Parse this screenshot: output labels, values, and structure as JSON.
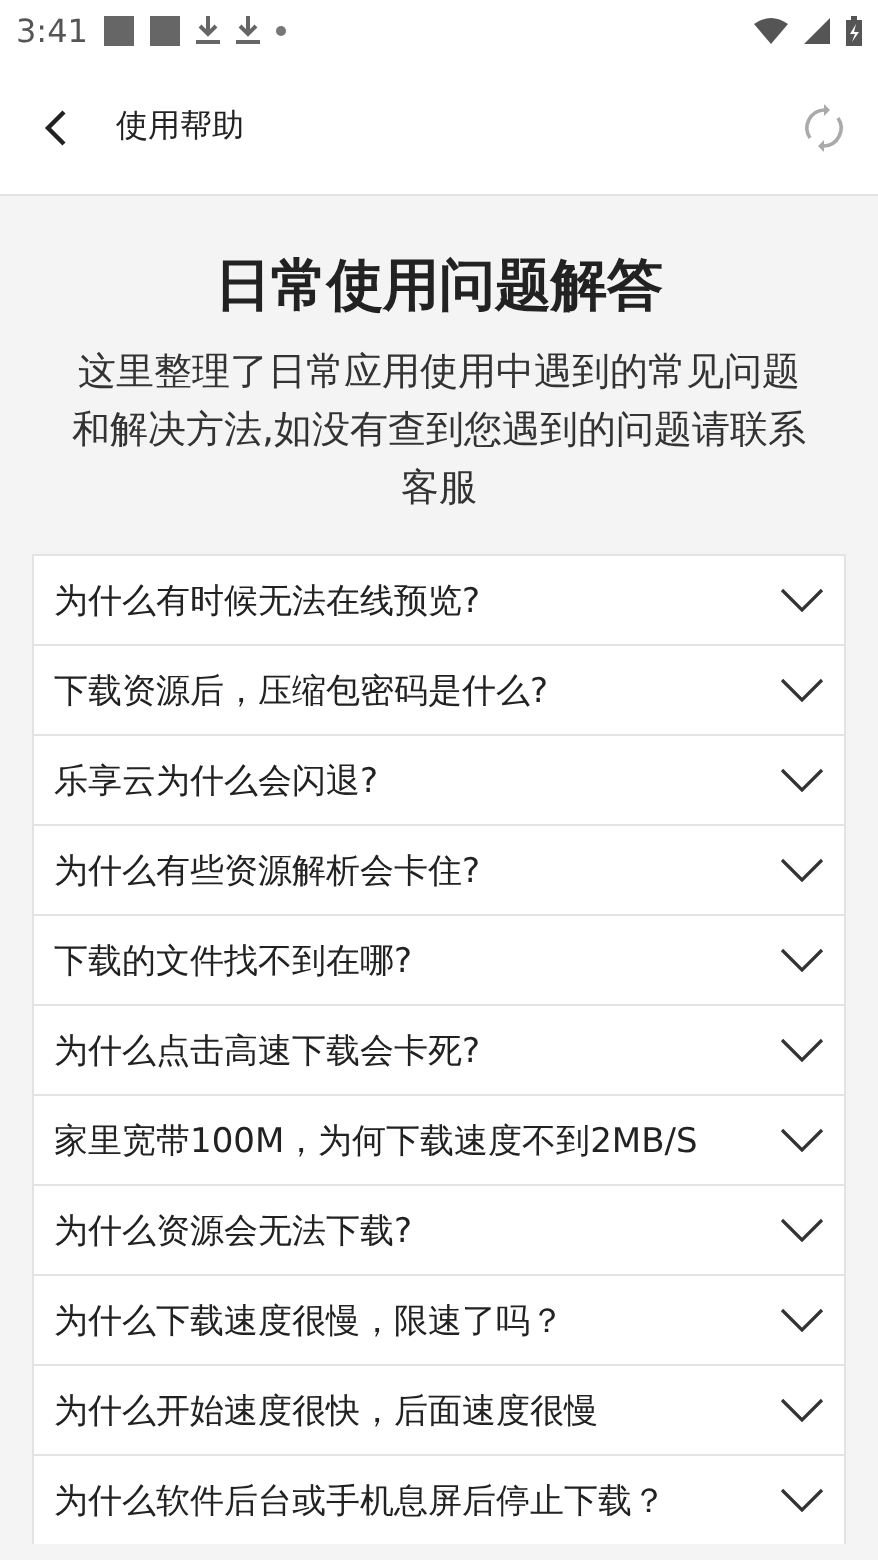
{
  "status_bar": {
    "time": "3:41"
  },
  "header": {
    "title": "使用帮助"
  },
  "intro": {
    "title": "日常使用问题解答",
    "description": "这里整理了日常应用使用中遇到的常见问题和解决方法,如没有查到您遇到的问题请联系客服"
  },
  "faq": [
    {
      "question": "为什么有时候无法在线预览?",
      "expanded": false
    },
    {
      "question": "下载资源后，压缩包密码是什么?",
      "expanded": false
    },
    {
      "question": "乐享云为什么会闪退?",
      "expanded": false
    },
    {
      "question": "为什么有些资源解析会卡住?",
      "expanded": false
    },
    {
      "question": "下载的文件找不到在哪?",
      "expanded": false
    },
    {
      "question": "为什么点击高速下载会卡死?",
      "expanded": false
    },
    {
      "question": "家里宽带100M，为何下载速度不到2MB/S",
      "expanded": false
    },
    {
      "question": "为什么资源会无法下载?",
      "expanded": false
    },
    {
      "question": "为什么下载速度很慢，限速了吗？",
      "expanded": false
    },
    {
      "question": "为什么开始速度很快，后面速度很慢",
      "expanded": false
    },
    {
      "question": "为什么软件后台或手机息屏后停止下载？",
      "expanded": false
    }
  ]
}
